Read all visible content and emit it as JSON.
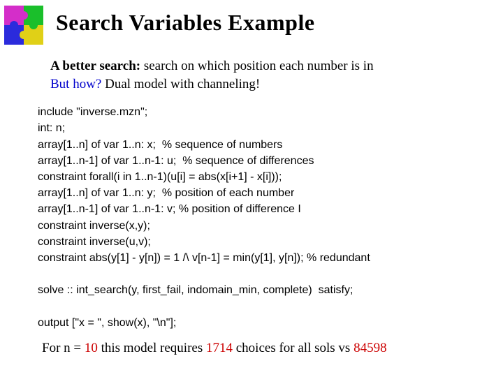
{
  "title": "Search Variables Example",
  "intro": {
    "line1_bold": "A better search:",
    "line1_rest": " search on which position each number is in",
    "line2_blue": "But how?",
    "line2_rest": " Dual model with channeling!"
  },
  "code": {
    "l1": "include \"inverse.mzn\";",
    "l2": "int: n;",
    "l3": "array[1..n] of var 1..n: x;  % sequence of numbers",
    "l4": "array[1..n-1] of var 1..n-1: u;  % sequence of differences",
    "l5": "constraint forall(i in 1..n-1)(u[i] = abs(x[i+1] - x[i]));",
    "l6": "array[1..n] of var 1..n: y;  % position of each number",
    "l7": "array[1..n-1] of var 1..n-1: v; % position of difference I",
    "l8": "constraint inverse(x,y);",
    "l9": "constraint inverse(u,v);",
    "l10": "constraint abs(y[1] - y[n]) = 1 /\\ v[n-1] = min(y[1], y[n]); % redundant",
    "sp1": " ",
    "l11": "solve :: int_search(y, first_fail, indomain_min, complete)  satisfy;",
    "sp2": " ",
    "l12": "output [\"x = \", show(x), \"\\n\"];"
  },
  "footer": {
    "t1": "For n = ",
    "n": "10",
    "t2": "  this model requires ",
    "choices": "1714",
    "t3": " choices for all sols vs ",
    "vs": "84598"
  }
}
